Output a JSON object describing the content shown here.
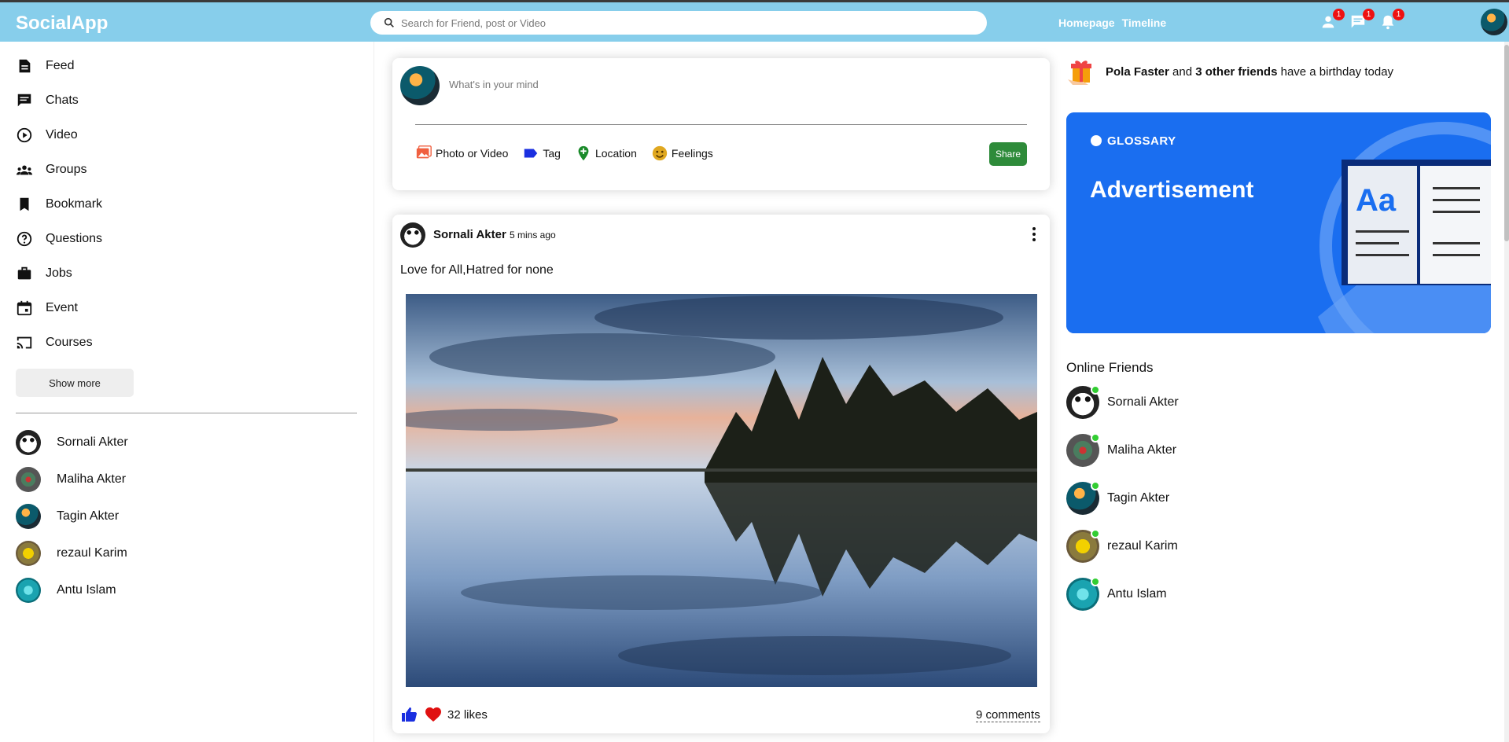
{
  "app": {
    "logo": "SocialApp"
  },
  "search": {
    "placeholder": "Search for Friend, post or Video"
  },
  "nav": {
    "links": [
      "Homepage",
      "Timeline"
    ]
  },
  "notifications": {
    "friend_requests": "1",
    "messages": "1",
    "alerts": "1"
  },
  "sidebar": {
    "items": [
      {
        "label": "Feed",
        "icon": "feed-icon"
      },
      {
        "label": "Chats",
        "icon": "chat-icon"
      },
      {
        "label": "Video",
        "icon": "play-circle-icon"
      },
      {
        "label": "Groups",
        "icon": "groups-icon"
      },
      {
        "label": "Bookmark",
        "icon": "bookmark-icon"
      },
      {
        "label": "Questions",
        "icon": "help-circle-icon"
      },
      {
        "label": "Jobs",
        "icon": "briefcase-icon"
      },
      {
        "label": "Event",
        "icon": "calendar-icon"
      },
      {
        "label": "Courses",
        "icon": "school-icon"
      }
    ],
    "show_more": "Show more",
    "friends": [
      "Sornali Akter",
      "Maliha Akter",
      "Tagin Akter",
      "rezaul Karim",
      "Antu Islam"
    ]
  },
  "share": {
    "placeholder": "What's in your mind",
    "options": [
      "Photo or Video",
      "Tag",
      "Location",
      "Feelings"
    ],
    "button": "Share"
  },
  "post": {
    "author": "Sornali Akter",
    "time": "5 mins ago",
    "text": "Love for All,Hatred for none",
    "likes": "32 likes",
    "comments": "9 comments"
  },
  "rightbar": {
    "birthday": {
      "name": "Pola Faster",
      "mid": " and ",
      "others": "3 other friends",
      "suffix": " have a birthday today"
    },
    "ad": {
      "brand": "GLOSSARY",
      "title": "Advertisement",
      "book_text": "Aa"
    },
    "online_title": "Online Friends",
    "online_friends": [
      "Sornali Akter",
      "Maliha Akter",
      "Tagin Akter",
      "rezaul Karim",
      "Antu Islam"
    ]
  },
  "colors": {
    "topbar": "#87ceeb",
    "share_button": "#2e8b3a",
    "online_dot": "#32cd32",
    "badge": "#e11",
    "ad_bg": "#1a6ef0"
  }
}
